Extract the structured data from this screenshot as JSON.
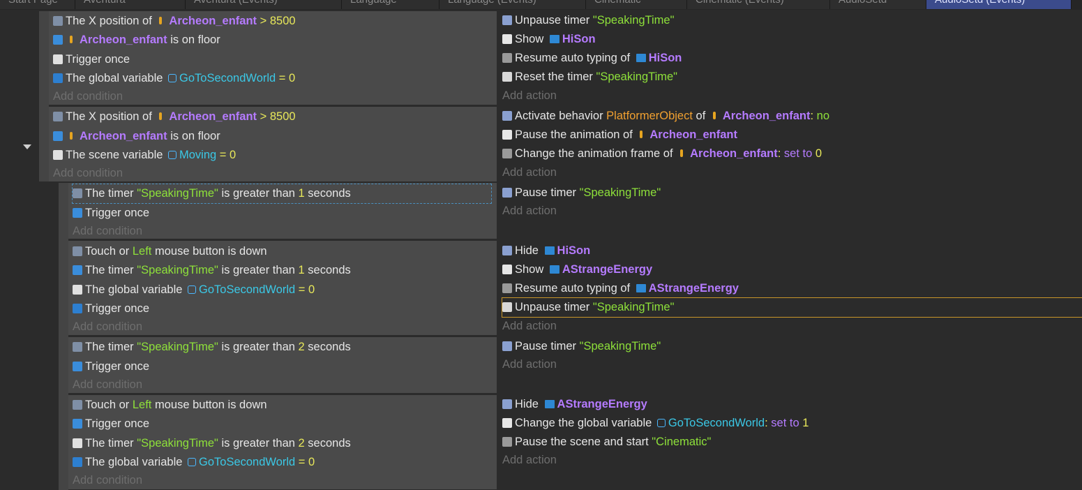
{
  "tabs": [
    "Start Page",
    "Aventura",
    "Aventura (Events)",
    "Language",
    "Language (Events)",
    "Cinematic",
    "Cinematic (Events)",
    "AudioSetd",
    "AudioSetd (Events)"
  ],
  "ui": {
    "add_condition": "Add condition",
    "add_action": "Add action"
  },
  "colors": {
    "string": "#8ee03a",
    "number": "#e8e85a",
    "object": "#b57bff",
    "variable": "#3bc8e6",
    "behavior": "#f0a030",
    "active_tab": "#3b4b8c"
  },
  "events": [
    {
      "conditions": [
        [
          {
            "t": "The X position of "
          },
          {
            "obj": "Archeon_enfant"
          },
          {
            "t": " > ",
            "cls": "o"
          },
          {
            "t": "8500",
            "cls": "o"
          }
        ],
        [
          {
            "obj": "Archeon_enfant"
          },
          {
            "t": " is on floor"
          }
        ],
        [
          {
            "t": "Trigger once"
          }
        ],
        [
          {
            "t": "The global variable "
          },
          {
            "var": "GoToSecondWorld"
          },
          {
            "t": " = ",
            "cls": "o"
          },
          {
            "t": "0",
            "cls": "o"
          }
        ]
      ],
      "actions": [
        [
          {
            "t": "Unpause timer "
          },
          {
            "t": "\"SpeakingTime\"",
            "cls": "g"
          }
        ],
        [
          {
            "t": "Show "
          },
          {
            "sprite": "HiSon"
          }
        ],
        [
          {
            "t": "Resume auto typing of "
          },
          {
            "sprite": "HiSon"
          }
        ],
        [
          {
            "t": "Reset the timer "
          },
          {
            "t": "\"SpeakingTime\"",
            "cls": "g"
          }
        ]
      ]
    },
    {
      "conditions": [
        [
          {
            "t": "The X position of "
          },
          {
            "obj": "Archeon_enfant"
          },
          {
            "t": " > ",
            "cls": "o"
          },
          {
            "t": "8500",
            "cls": "o"
          }
        ],
        [
          {
            "obj": "Archeon_enfant"
          },
          {
            "t": " is on floor"
          }
        ],
        [
          {
            "t": "The scene variable "
          },
          {
            "var": "Moving"
          },
          {
            "t": " = ",
            "cls": "o"
          },
          {
            "t": "0",
            "cls": "o"
          }
        ]
      ],
      "actions": [
        [
          {
            "t": "Activate behavior "
          },
          {
            "t": "PlatformerObject",
            "cls": "or"
          },
          {
            "t": " of "
          },
          {
            "obj": "Archeon_enfant"
          },
          {
            "t": ": ",
            "cls": "o"
          },
          {
            "t": "no",
            "cls": "g"
          }
        ],
        [
          {
            "t": "Pause the animation of "
          },
          {
            "obj": "Archeon_enfant"
          }
        ],
        [
          {
            "t": "Change the animation frame of "
          },
          {
            "obj": "Archeon_enfant"
          },
          {
            "t": ": ",
            "cls": "o"
          },
          {
            "t": "set to ",
            "cls": "v"
          },
          {
            "t": "0",
            "cls": "o"
          }
        ]
      ]
    },
    {
      "conditions": [
        [
          {
            "t": "The timer "
          },
          {
            "t": "\"SpeakingTime\"",
            "cls": "g"
          },
          {
            "t": " is greater than "
          },
          {
            "t": "1",
            "cls": "o"
          },
          {
            "t": " seconds"
          }
        ],
        [
          {
            "t": "Trigger once"
          }
        ]
      ],
      "actions": [
        [
          {
            "t": "Pause timer "
          },
          {
            "t": "\"SpeakingTime\"",
            "cls": "g"
          }
        ]
      ]
    },
    {
      "conditions": [
        [
          {
            "t": "Touch or "
          },
          {
            "t": "Left",
            "cls": "g"
          },
          {
            "t": " mouse button is down"
          }
        ],
        [
          {
            "t": "The timer "
          },
          {
            "t": "\"SpeakingTime\"",
            "cls": "g"
          },
          {
            "t": " is greater than "
          },
          {
            "t": "1",
            "cls": "o"
          },
          {
            "t": " seconds"
          }
        ],
        [
          {
            "t": "The global variable "
          },
          {
            "var": "GoToSecondWorld"
          },
          {
            "t": " = ",
            "cls": "o"
          },
          {
            "t": "0",
            "cls": "o"
          }
        ],
        [
          {
            "t": "Trigger once"
          }
        ]
      ],
      "actions": [
        [
          {
            "t": "Hide "
          },
          {
            "sprite": "HiSon"
          }
        ],
        [
          {
            "t": "Show "
          },
          {
            "sprite": "AStrangeEnergy"
          }
        ],
        [
          {
            "t": "Resume auto typing of "
          },
          {
            "sprite": "AStrangeEnergy"
          }
        ],
        [
          {
            "t": "Unpause timer "
          },
          {
            "t": "\"SpeakingTime\"",
            "cls": "g"
          }
        ]
      ]
    },
    {
      "conditions": [
        [
          {
            "t": "The timer "
          },
          {
            "t": "\"SpeakingTime\"",
            "cls": "g"
          },
          {
            "t": " is greater than "
          },
          {
            "t": "2",
            "cls": "o"
          },
          {
            "t": " seconds"
          }
        ],
        [
          {
            "t": "Trigger once"
          }
        ]
      ],
      "actions": [
        [
          {
            "t": "Pause timer "
          },
          {
            "t": "\"SpeakingTime\"",
            "cls": "g"
          }
        ]
      ]
    },
    {
      "conditions": [
        [
          {
            "t": "Touch or "
          },
          {
            "t": "Left",
            "cls": "g"
          },
          {
            "t": " mouse button is down"
          }
        ],
        [
          {
            "t": "Trigger once"
          }
        ],
        [
          {
            "t": "The timer "
          },
          {
            "t": "\"SpeakingTime\"",
            "cls": "g"
          },
          {
            "t": " is greater than "
          },
          {
            "t": "2",
            "cls": "o"
          },
          {
            "t": " seconds"
          }
        ],
        [
          {
            "t": "The global variable "
          },
          {
            "var": "GoToSecondWorld"
          },
          {
            "t": " = ",
            "cls": "o"
          },
          {
            "t": "0",
            "cls": "o"
          }
        ]
      ],
      "actions": [
        [
          {
            "t": "Hide "
          },
          {
            "sprite": "AStrangeEnergy"
          }
        ],
        [
          {
            "t": "Change the global variable "
          },
          {
            "var": "GoToSecondWorld"
          },
          {
            "t": ": ",
            "cls": "o"
          },
          {
            "t": "set to ",
            "cls": "v"
          },
          {
            "t": "1",
            "cls": "o"
          }
        ],
        [
          {
            "t": "Pause the scene and start "
          },
          {
            "t": "\"Cinematic\"",
            "cls": "g"
          }
        ]
      ]
    }
  ]
}
